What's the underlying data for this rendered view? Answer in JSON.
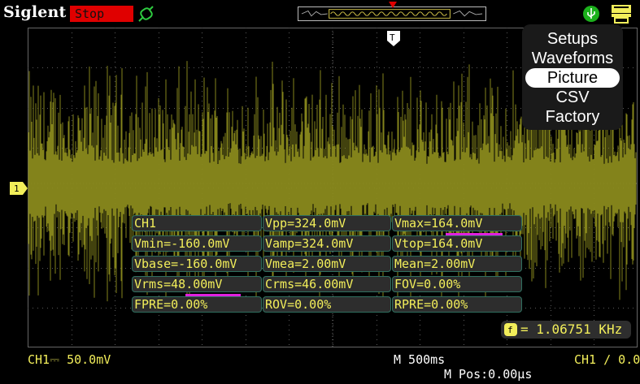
{
  "header": {
    "brand": "Siglent",
    "status": "Stop"
  },
  "menu": {
    "items": [
      {
        "label": "Setups",
        "selected": false
      },
      {
        "label": "Waveforms",
        "selected": false
      },
      {
        "label": "Picture",
        "selected": true
      },
      {
        "label": "CSV",
        "selected": false
      },
      {
        "label": "Factory",
        "selected": false
      }
    ]
  },
  "measurements": {
    "title": "CH1",
    "vpp": "Vpp=324.0mV",
    "vmax": "Vmax=164.0mV",
    "vmin": "Vmin=-160.0mV",
    "vamp": "Vamp=324.0mV",
    "vtop": "Vtop=164.0mV",
    "vbase": "Vbase=-160.0mV",
    "vmea": "Vmea=2.00mV",
    "mean": "Mean=2.00mV",
    "vrms": "Vrms=48.00mV",
    "crms": "Crms=46.00mV",
    "fov": "FOV=0.00%",
    "fpre": "FPRE=0.00%",
    "rov": "ROV=0.00%",
    "rpre": "RPRE=0.00%"
  },
  "frequency": "= 1.06751 KHz",
  "footer": {
    "channel": "CH1⎓ 50.0mV",
    "timebase": "M 500ms",
    "position": "M Pos:0.00μs",
    "trigger": "CH1 ∕ 0.0"
  },
  "colors": {
    "waveform": "#8a8a1c",
    "accent": "#f2ee5a",
    "status_bg": "#e00000",
    "highlight": "#e020e0"
  }
}
